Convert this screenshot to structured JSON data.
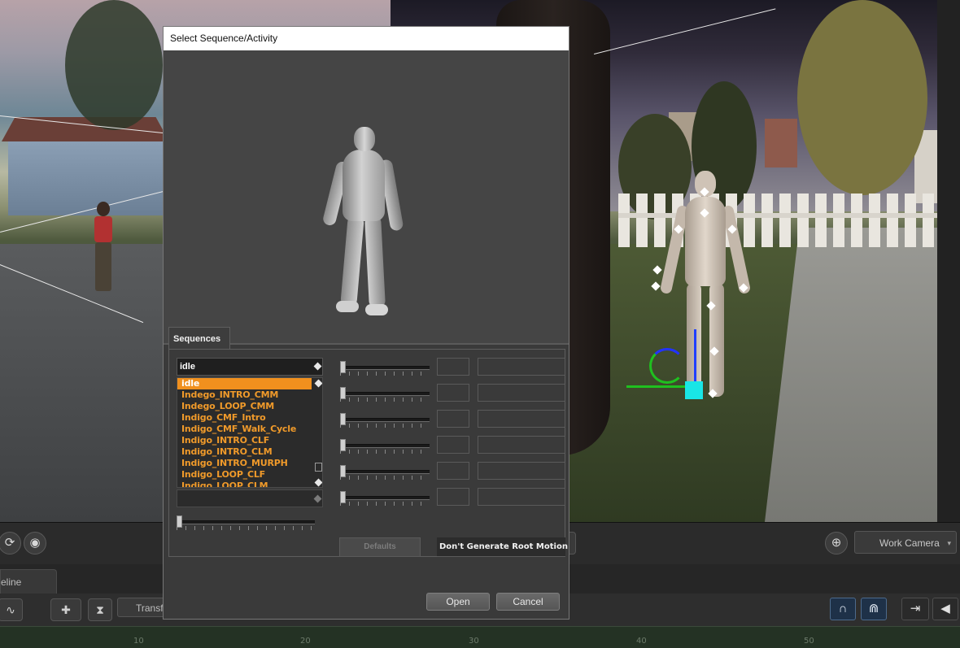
{
  "dialog": {
    "title": "Select Sequence/Activity",
    "tabs": [
      {
        "label": "Sequences"
      }
    ],
    "selected_sequence": "idle",
    "sequences": [
      "idle",
      "Indego_INTRO_CMM",
      "Indego_LOOP_CMM",
      "Indigo_CMF_Intro",
      "Indigo_CMF_Walk_Cycle",
      "Indigo_INTRO_CLF",
      "Indigo_INTRO_CLM",
      "Indigo_INTRO_MURPH",
      "Indigo_LOOP_CLF",
      "Indigo_LOOP_CLM"
    ],
    "defaults_label": "Defaults",
    "root_motion_label": "Don't Generate Root Motion",
    "open_label": "Open",
    "cancel_label": "Cancel"
  },
  "background": {
    "camera_label": "Work Camera",
    "timeline_tab_label": "eline",
    "transform_button_label": "Transf",
    "ruler_numbers": [
      "10",
      "20",
      "30",
      "40",
      "50"
    ]
  },
  "colors": {
    "sequence_text": "#f09a2a",
    "selected_row": "#f0901e",
    "gizmo_cube": "#19e6e6"
  }
}
